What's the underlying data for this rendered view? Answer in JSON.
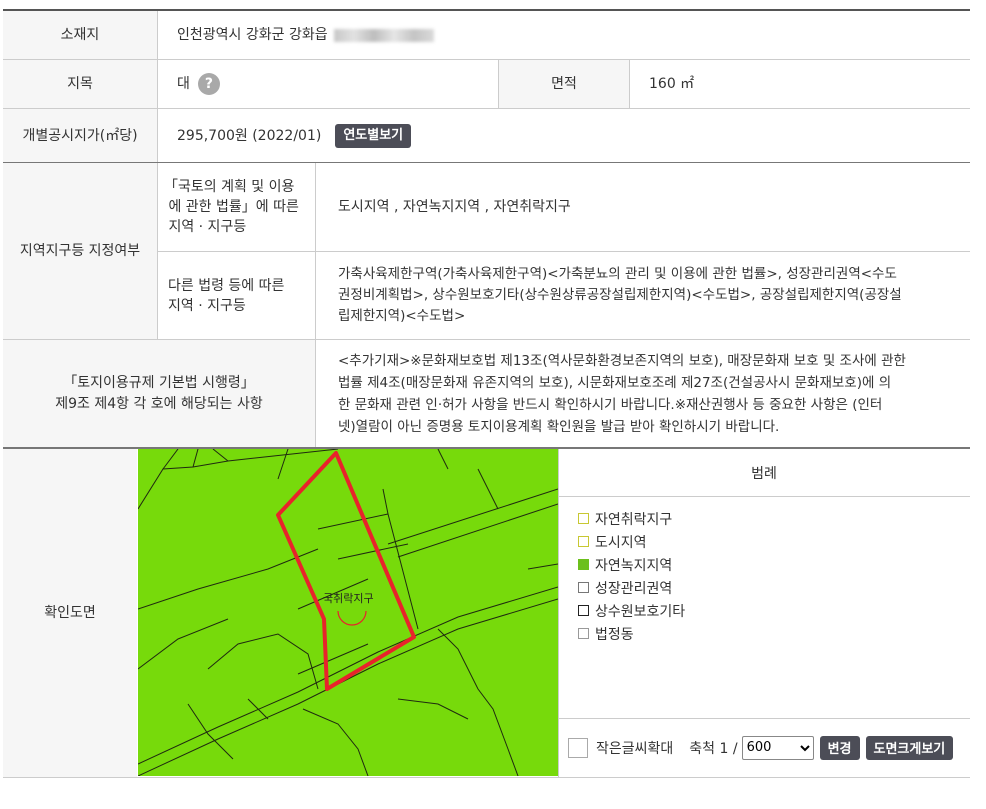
{
  "location": {
    "label": "소재지",
    "value": "인천광역시 강화군 강화읍"
  },
  "land_category": {
    "label": "지목",
    "value": "대",
    "help_icon": "?"
  },
  "area": {
    "label": "면적",
    "value": "160 ㎡"
  },
  "official_price": {
    "label": "개별공시지가(㎡당)",
    "value": "295,700원 (2022/01)",
    "button": "연도별보기"
  },
  "zoning": {
    "label": "지역지구등 지정여부",
    "national_law": {
      "label": "「국토의 계획 및 이용\n 에 관한 법률」에 따른\n 지역 · 지구등",
      "value": "도시지역 , 자연녹지지역 , 자연취락지구"
    },
    "other_law": {
      "label": "다른 법령 등에 따른\n지역 · 지구등",
      "value": "가축사육제한구역(가축사육제한구역)<가축분뇨의 관리 및 이용에 관한 법률>, 성장관리권역<수도\n권정비계획법>, 상수원보호기타(상수원상류공장설립제한지역)<수도법>, 공장설립제한지역(공장설\n립제한지역)<수도법>"
    }
  },
  "regulation": {
    "label": "「토지이용규제 기본법 시행령」\n제9조 제4항 각 호에 해당되는 사항",
    "value": "<추가기재>※문화재보호법 제13조(역사문화환경보존지역의 보호), 매장문화재 보호 및 조사에 관한\n법률 제4조(매장문화재 유존지역의 보호), 시문화재보호조례 제27조(건설공사시 문화재보호)에 의\n한 문화재 관련 인·허가 사항을 반드시 확인하시기 바랍니다.※재산권행사 등 중요한 사항은 (인터\n넷)열람이 아닌 증명용 토지이용계획 확인원을 발급 받아 확인하시기 바랍니다."
  },
  "map_section": {
    "label": "확인도면",
    "map_text": "국취락지구",
    "legend_title": "범례",
    "legend": [
      {
        "label": "자연취락지구",
        "border": "#c8c832",
        "fill": "#ffffff"
      },
      {
        "label": "도시지역",
        "border": "#c8c832",
        "fill": "#ffffff"
      },
      {
        "label": "자연녹지지역",
        "border": "#6cc01c",
        "fill": "#6cc01c"
      },
      {
        "label": "성장관리권역",
        "border": "#777777",
        "fill": "#ffffff"
      },
      {
        "label": "상수원보호기타",
        "border": "#222222",
        "fill": "#ffffff"
      },
      {
        "label": "법정동",
        "border": "#999999",
        "fill": "#ffffff"
      }
    ],
    "enlarge_text_label": "작은글씨확대",
    "scale_label": "축척 1 /",
    "scale_value": "600",
    "change_button": "변경",
    "view_large_button": "도면크게보기"
  },
  "colors": {
    "map_green": "#77da0b",
    "parcel_red": "#e8232b",
    "button_dark": "#4c4d57",
    "header_bg": "#f6f6f6"
  }
}
